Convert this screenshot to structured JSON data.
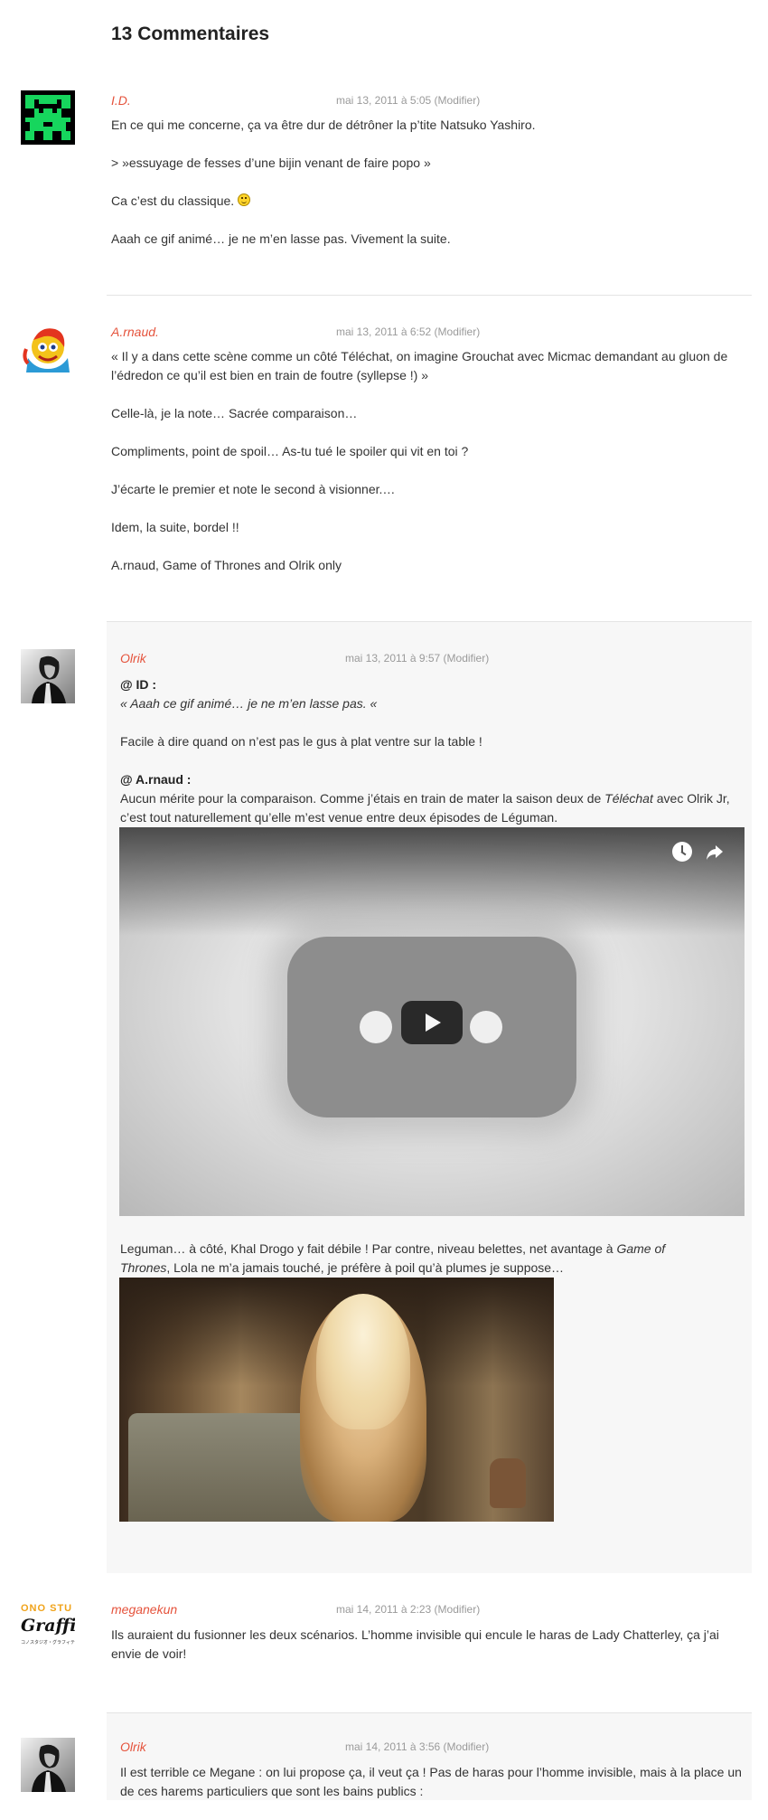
{
  "comments_title": "13 Commentaires",
  "accent_color": "#e5533c",
  "comments": [
    {
      "author": "I.D.",
      "date": "mai 13, 2011 à 5:05",
      "edit": "(Modifier)",
      "avatar_icon": "space-invader-icon",
      "paragraphs": [
        "En ce qui me concerne, ça va être dur de détrôner la p’tite Natsuko Yashiro.",
        "> »essuyage de fesses d’une bijin venant de faire popo »",
        "Ca c’est du classique.",
        "Aaah ce gif animé… je ne m’en lasse pas. Vivement la suite."
      ]
    },
    {
      "author": "A.rnaud.",
      "date": "mai 13, 2011 à 6:52",
      "edit": "(Modifier)",
      "avatar_icon": "mascot-avatar-icon",
      "paragraphs": [
        "« Il y a dans cette scène comme un côté Téléchat, on imagine Grouchat avec  Micmac demandant au gluon de l’édredon ce qu’il est bien en train de foutre (syllepse !) »",
        "Celle-là, je la note… Sacrée comparaison…",
        "Compliments, point de spoil… As-tu tué le spoiler qui vit en toi ?",
        "J’écarte le premier et note le second à visionner.…",
        "Idem, la suite, bordel !!",
        "A.rnaud, Game of Thrones and Olrik only"
      ]
    },
    {
      "author": "Olrik",
      "date": "mai 13, 2011 à 9:57",
      "edit": "(Modifier)",
      "avatar_icon": "portrait-avatar-icon",
      "reply1_head": "@ ID :",
      "reply1_quote": "« Aaah ce gif animé… je ne m’en lasse pas. «",
      "reply1_text": "Facile à dire quand on n’est pas le gus à plat ventre sur la table !",
      "reply2_head": "@ A.rnaud :",
      "reply2_text_a": "Aucun mérite pour la comparaison. Comme j’étais en train de mater la saison deux de ",
      "reply2_italic": "Téléchat",
      "reply2_text_b": " avec Olrik Jr, c’est tout naturellement qu’elle m’est venue entre deux épisodes de Léguman.",
      "after_video_a": "Leguman… à côté, Khal Drogo y fait débile ! Par contre, niveau belettes, net avantage à ",
      "after_video_italic": "Game of Thrones",
      "after_video_b": ", Lola ne m’a jamais touché, je préfère à poil qu’à plumes je suppose…"
    },
    {
      "author": "meganekun",
      "date": "mai 14, 2011 à 2:23",
      "edit": "(Modifier)",
      "avatar_brand_top": "ONO STU",
      "avatar_brand_main": "Graffiti",
      "avatar_brand_sub": "コノスタジオ・グラフィティ",
      "paragraphs": [
        "Ils auraient du fusionner les deux scénarios. L’homme invisible qui encule le haras de Lady Chatterley, ça j’ai envie de voir!"
      ]
    },
    {
      "author": "Olrik",
      "date": "mai 14, 2011 à 3:56",
      "edit": "(Modifier)",
      "avatar_icon": "portrait-avatar-icon",
      "paragraphs": [
        "Il est terrible ce Megane : on lui propose ça, il veut ça ! Pas de haras pour l’homme invisible, mais à la place un de ces harems particuliers que sont les bains publics :"
      ]
    }
  ]
}
